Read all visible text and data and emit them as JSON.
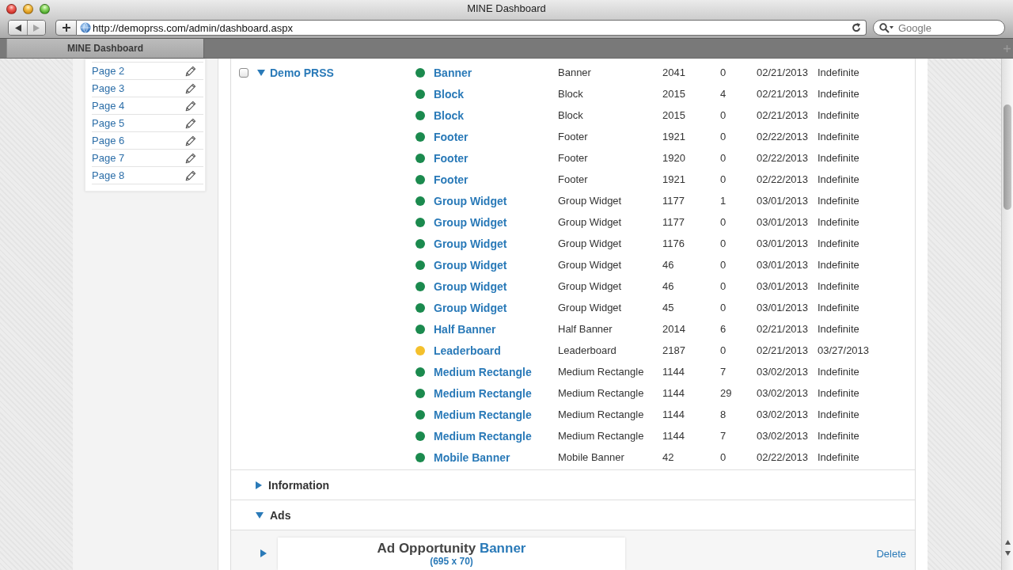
{
  "window": {
    "title": "MINE Dashboard"
  },
  "toolbar": {
    "navigation": [
      {
        "kind": "back",
        "disabled": false
      },
      {
        "kind": "forward",
        "disabled": true
      }
    ],
    "address": "http://demoprss.com/admin/dashboard.aspx",
    "search": {
      "placeholder": "Google"
    }
  },
  "tabs": [
    {
      "label": "MINE Dashboard",
      "selected": true
    }
  ],
  "sidebar": {
    "items": [
      {
        "label": "Page 2"
      },
      {
        "label": "Page 3"
      },
      {
        "label": "Page 4"
      },
      {
        "label": "Page 5"
      },
      {
        "label": "Page 6"
      },
      {
        "label": "Page 7"
      },
      {
        "label": "Page 8"
      }
    ]
  },
  "tree": {
    "group": {
      "label": "Demo PRSS",
      "checked": false,
      "expanded": true
    },
    "rows": [
      {
        "color": "#1b8a4e",
        "cells": [
          "Banner",
          "Banner",
          "2041",
          "0",
          "02/21/2013",
          "Indefinite"
        ]
      },
      {
        "color": "#1b8a4e",
        "cells": [
          "Block",
          "Block",
          "2015",
          "4",
          "02/21/2013",
          "Indefinite"
        ]
      },
      {
        "color": "#1b8a4e",
        "cells": [
          "Block",
          "Block",
          "2015",
          "0",
          "02/21/2013",
          "Indefinite"
        ]
      },
      {
        "color": "#1b8a4e",
        "cells": [
          "Footer",
          "Footer",
          "1921",
          "0",
          "02/22/2013",
          "Indefinite"
        ]
      },
      {
        "color": "#1b8a4e",
        "cells": [
          "Footer",
          "Footer",
          "1920",
          "0",
          "02/22/2013",
          "Indefinite"
        ]
      },
      {
        "color": "#1b8a4e",
        "cells": [
          "Footer",
          "Footer",
          "1921",
          "0",
          "02/22/2013",
          "Indefinite"
        ]
      },
      {
        "color": "#1b8a4e",
        "cells": [
          "Group Widget",
          "Group Widget",
          "1177",
          "1",
          "03/01/2013",
          "Indefinite"
        ]
      },
      {
        "color": "#1b8a4e",
        "cells": [
          "Group Widget",
          "Group Widget",
          "1177",
          "0",
          "03/01/2013",
          "Indefinite"
        ]
      },
      {
        "color": "#1b8a4e",
        "cells": [
          "Group Widget",
          "Group Widget",
          "1176",
          "0",
          "03/01/2013",
          "Indefinite"
        ]
      },
      {
        "color": "#1b8a4e",
        "cells": [
          "Group Widget",
          "Group Widget",
          "46",
          "0",
          "03/01/2013",
          "Indefinite"
        ]
      },
      {
        "color": "#1b8a4e",
        "cells": [
          "Group Widget",
          "Group Widget",
          "46",
          "0",
          "03/01/2013",
          "Indefinite"
        ]
      },
      {
        "color": "#1b8a4e",
        "cells": [
          "Group Widget",
          "Group Widget",
          "45",
          "0",
          "03/01/2013",
          "Indefinite"
        ]
      },
      {
        "color": "#1b8a4e",
        "cells": [
          "Half Banner",
          "Half Banner",
          "2014",
          "6",
          "02/21/2013",
          "Indefinite"
        ]
      },
      {
        "color": "#f4c02c",
        "cells": [
          "Leaderboard",
          "Leaderboard",
          "2187",
          "0",
          "02/21/2013",
          "03/27/2013"
        ]
      },
      {
        "color": "#1b8a4e",
        "cells": [
          "Medium Rectangle",
          "Medium Rectangle",
          "1144",
          "7",
          "03/02/2013",
          "Indefinite"
        ]
      },
      {
        "color": "#1b8a4e",
        "cells": [
          "Medium Rectangle",
          "Medium Rectangle",
          "1144",
          "29",
          "03/02/2013",
          "Indefinite"
        ]
      },
      {
        "color": "#1b8a4e",
        "cells": [
          "Medium Rectangle",
          "Medium Rectangle",
          "1144",
          "8",
          "03/02/2013",
          "Indefinite"
        ]
      },
      {
        "color": "#1b8a4e",
        "cells": [
          "Medium Rectangle",
          "Medium Rectangle",
          "1144",
          "7",
          "03/02/2013",
          "Indefinite"
        ]
      },
      {
        "color": "#1b8a4e",
        "cells": [
          "Mobile Banner",
          "Mobile Banner",
          "42",
          "0",
          "02/22/2013",
          "Indefinite"
        ]
      }
    ]
  },
  "sections": [
    {
      "label": "Information",
      "expanded": false
    },
    {
      "label": "Ads",
      "expanded": true,
      "ads": [
        {
          "expanded": false,
          "title": "Ad Opportunity",
          "title_accent": "Banner",
          "size": "(695 x 70)",
          "action": "Delete"
        }
      ]
    }
  ]
}
